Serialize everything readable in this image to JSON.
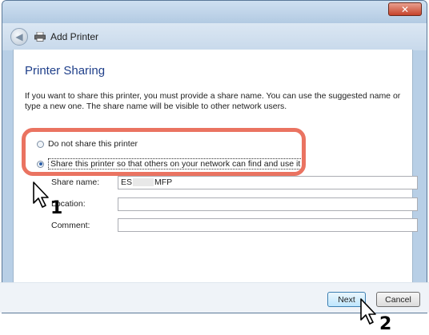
{
  "window": {
    "close_label": "✕"
  },
  "nav": {
    "title": "Add Printer",
    "back_icon": "back-arrow-icon",
    "printer_icon": "printer-icon"
  },
  "page": {
    "heading": "Printer Sharing",
    "description": "If you want to share this printer, you must provide a share name. You can use the suggested name or type a new one. The share name will be visible to other network users."
  },
  "options": {
    "no_share": "Do not share this printer",
    "share": "Share this printer so that others on your network can find and use it",
    "selected": "share"
  },
  "fields": {
    "share_name_label": "Share name:",
    "share_name_value_prefix": "ES",
    "share_name_value_suffix": "MFP",
    "location_label": "Location:",
    "location_value": "",
    "comment_label": "Comment:",
    "comment_value": ""
  },
  "buttons": {
    "next": "Next",
    "cancel": "Cancel"
  },
  "callouts": {
    "step1": "1",
    "step2": "2"
  },
  "colors": {
    "highlight": "#ea7361",
    "heading": "#1f3f8a"
  }
}
